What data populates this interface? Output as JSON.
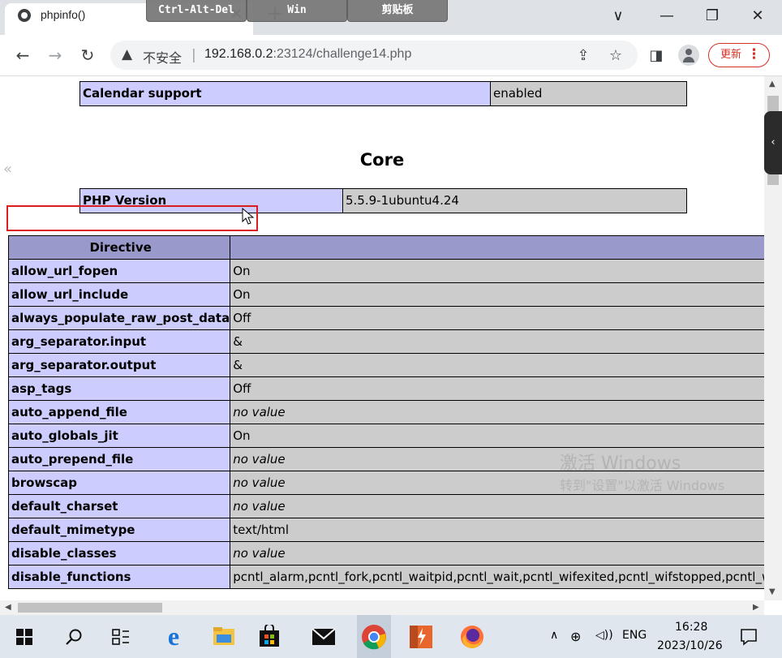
{
  "browser": {
    "tab_title": "phpinfo()",
    "tab_close": "✕",
    "new_tab": "+",
    "remote_toolbar": [
      "Ctrl-Alt-Del",
      "Win",
      "剪贴板"
    ],
    "window_controls": [
      "∨",
      "—",
      "❐",
      "✕"
    ],
    "security_label": "不安全",
    "url_host": "192.168.0.2",
    "url_path": ":23124/challenge14.php",
    "update_label": "更新",
    "menu_dots": "⋮"
  },
  "page": {
    "calendar": {
      "name": "Calendar support",
      "value": "enabled"
    },
    "section_title": "Core",
    "php_version": {
      "name": "PHP Version",
      "value": "5.5.9-1ubuntu4.24"
    },
    "directive_header": [
      "Directive",
      ""
    ],
    "directives": [
      {
        "name": "allow_url_fopen",
        "value": "On",
        "novalue": false
      },
      {
        "name": "allow_url_include",
        "value": "On",
        "novalue": false
      },
      {
        "name": "always_populate_raw_post_data",
        "value": "Off",
        "novalue": false
      },
      {
        "name": "arg_separator.input",
        "value": "&",
        "novalue": false
      },
      {
        "name": "arg_separator.output",
        "value": "&",
        "novalue": false
      },
      {
        "name": "asp_tags",
        "value": "Off",
        "novalue": false
      },
      {
        "name": "auto_append_file",
        "value": "no value",
        "novalue": true
      },
      {
        "name": "auto_globals_jit",
        "value": "On",
        "novalue": false
      },
      {
        "name": "auto_prepend_file",
        "value": "no value",
        "novalue": true
      },
      {
        "name": "browscap",
        "value": "no value",
        "novalue": true
      },
      {
        "name": "default_charset",
        "value": "no value",
        "novalue": true
      },
      {
        "name": "default_mimetype",
        "value": "text/html",
        "novalue": false
      },
      {
        "name": "disable_classes",
        "value": "no value",
        "novalue": true
      },
      {
        "name": "disable_functions",
        "value": "pcntl_alarm,pcntl_fork,pcntl_waitpid,pcntl_wait,pcntl_wifexited,pcntl_wifstopped,pcntl_wifsignaled",
        "novalue": false
      }
    ],
    "highlighted_directive": "allow_url_include",
    "watermark_line1": "激活 Windows",
    "watermark_line2": "转到\"设置\"以激活 Windows"
  },
  "taskbar": {
    "ime": "ENG",
    "time": "16:28",
    "date": "2023/10/26"
  },
  "colors": {
    "entry": "#ccccff",
    "value": "#cccccc",
    "header": "#9999cc",
    "highlight": "#d81e1e"
  }
}
